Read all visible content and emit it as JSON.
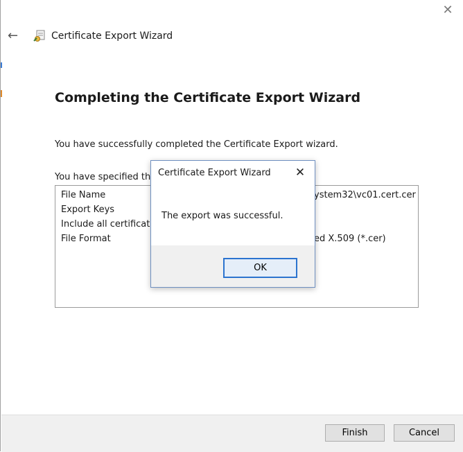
{
  "window": {
    "title": "Certificate Export Wizard",
    "close_glyph": "✕",
    "back_glyph": "←"
  },
  "page": {
    "heading": "Completing the Certificate Export Wizard",
    "success_text": "You have successfully completed the Certificate Export wizard.",
    "specified_text": "You have specified the",
    "settings": [
      {
        "label": "File Name",
        "value": "ystem32\\vc01.cert.cer"
      },
      {
        "label": "Export Keys",
        "value": ""
      },
      {
        "label": "Include all certificates",
        "value": ""
      },
      {
        "label": "File Format",
        "value": "ed X.509 (*.cer)"
      }
    ]
  },
  "footer": {
    "finish_label": "Finish",
    "cancel_label": "Cancel"
  },
  "dialog": {
    "title": "Certificate Export Wizard",
    "message": "The export was successful.",
    "ok_label": "OK",
    "close_glyph": "✕"
  },
  "colors": {
    "accent": "#2b73cf",
    "footer_bg": "#f0f0f0"
  }
}
